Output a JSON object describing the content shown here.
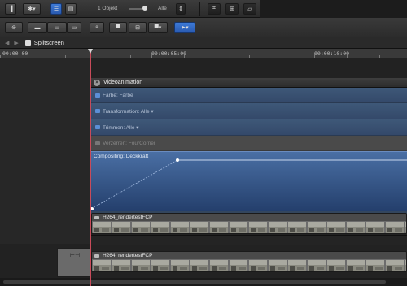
{
  "topbar": {
    "object_count": "1 Objekt",
    "filter_label": "Alle"
  },
  "breadcrumb": {
    "project": "Splitscreen"
  },
  "ruler": {
    "timecodes": [
      "00:00:00",
      "00:00:05:00",
      "00:00:10:00"
    ]
  },
  "video_animation": {
    "title": "Videoanimation",
    "rows": [
      {
        "label": "Farbe: Farbe"
      },
      {
        "label": "Transformation: Alle ▾"
      },
      {
        "label": "Trimmen: Alle ▾"
      },
      {
        "label": "Verzerren: FourCorner"
      }
    ],
    "compositing_label": "Compositing: Deckkraft"
  },
  "clips": [
    {
      "name": "H264_rendertestFCP"
    },
    {
      "name": "H264_rendertestFCP"
    }
  ],
  "colors": {
    "accent_blue": "#2a5ab0",
    "playhead": "#c84b5a",
    "panel_blue": "#33465e"
  }
}
